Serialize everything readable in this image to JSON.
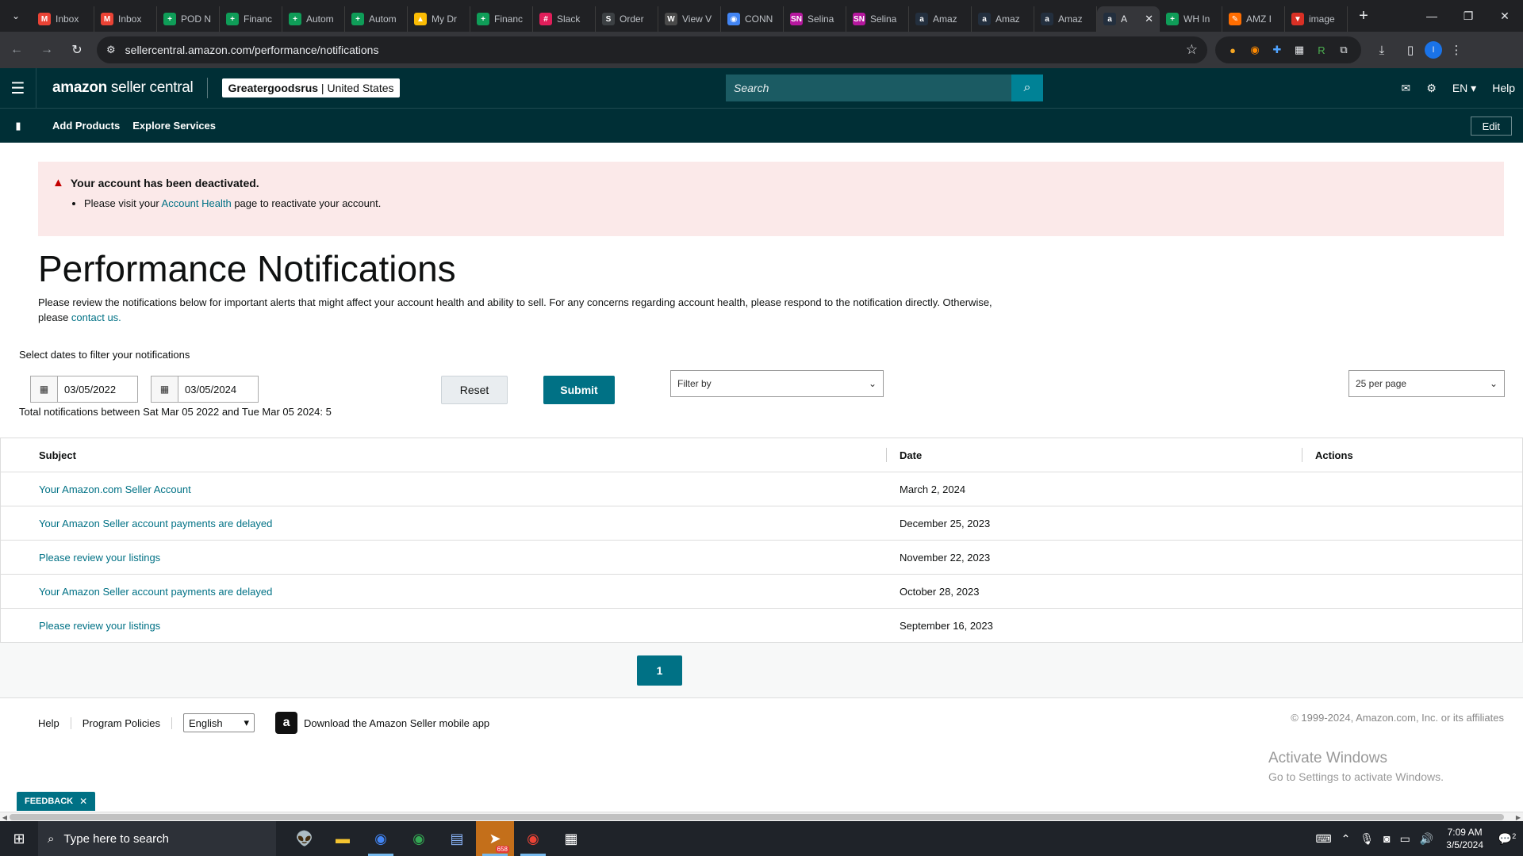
{
  "browser": {
    "tabs": [
      {
        "label": "Inbox",
        "icon": "gmail-icon",
        "color": "#ea4335",
        "glyph": "M"
      },
      {
        "label": "Inbox",
        "icon": "gmail-icon",
        "color": "#ea4335",
        "glyph": "M"
      },
      {
        "label": "POD N",
        "icon": "sheets-icon",
        "color": "#0f9d58",
        "glyph": "+"
      },
      {
        "label": "Financ",
        "icon": "sheets-icon",
        "color": "#0f9d58",
        "glyph": "+"
      },
      {
        "label": "Autom",
        "icon": "sheets-icon",
        "color": "#0f9d58",
        "glyph": "+"
      },
      {
        "label": "Autom",
        "icon": "sheets-icon",
        "color": "#0f9d58",
        "glyph": "+"
      },
      {
        "label": "My Dr",
        "icon": "drive-icon",
        "color": "#fbbc04",
        "glyph": "▲"
      },
      {
        "label": "Financ",
        "icon": "sheets-icon",
        "color": "#0f9d58",
        "glyph": "+"
      },
      {
        "label": "Slack",
        "icon": "slack-icon",
        "color": "#e01e5a",
        "glyph": "#"
      },
      {
        "label": "Order",
        "icon": "sw-icon",
        "color": "#3c4043",
        "glyph": "S"
      },
      {
        "label": "View V",
        "icon": "w-icon",
        "color": "#4a4a4a",
        "glyph": "W"
      },
      {
        "label": "CONN",
        "icon": "chrome-icon",
        "color": "#4285f4",
        "glyph": "◉"
      },
      {
        "label": "Selina",
        "icon": "sn-icon",
        "color": "#b5179e",
        "glyph": "SN"
      },
      {
        "label": "Selina",
        "icon": "sn-icon",
        "color": "#b5179e",
        "glyph": "SN"
      },
      {
        "label": "Amaz",
        "icon": "amazon-icon",
        "color": "#232f3e",
        "glyph": "a"
      },
      {
        "label": "Amaz",
        "icon": "amazon-icon",
        "color": "#232f3e",
        "glyph": "a"
      },
      {
        "label": "Amaz",
        "icon": "amazon-icon",
        "color": "#232f3e",
        "glyph": "a"
      },
      {
        "label": "A",
        "icon": "amazon-icon",
        "color": "#232f3e",
        "glyph": "a",
        "active": true
      },
      {
        "label": "WH In",
        "icon": "sheets-icon",
        "color": "#0f9d58",
        "glyph": "+"
      },
      {
        "label": "AMZ I",
        "icon": "pen-icon",
        "color": "#ff6d00",
        "glyph": "✎"
      },
      {
        "label": "image",
        "icon": "image-icon",
        "color": "#d93025",
        "glyph": "▼"
      }
    ],
    "url": "sellercentral.amazon.com/performance/notifications"
  },
  "header": {
    "logo_main": "amazon",
    "logo_sub": " seller central",
    "store_name": "Greatergoodsrus",
    "store_region": " | United States",
    "search_placeholder": "Search",
    "lang": "EN ▾",
    "help": "Help"
  },
  "nav": {
    "add_products": "Add Products",
    "explore_services": "Explore Services",
    "edit": "Edit"
  },
  "alert": {
    "title": "Your account has been deactivated.",
    "pre": "Please visit your ",
    "link": "Account Health",
    "post": " page to reactivate your account."
  },
  "page": {
    "title": "Performance Notifications",
    "desc_pre": "Please review the notifications below for important alerts that might affect your account health and ability to sell. For any concerns regarding account health, please respond to the notification directly. Otherwise, please ",
    "desc_link": "contact us.",
    "filter_label": "Select dates to filter your notifications",
    "date_from": "03/05/2022",
    "date_to": "03/05/2024",
    "reset": "Reset",
    "submit": "Submit",
    "filter_by": "Filter by",
    "per_page": "25 per page",
    "total": "Total notifications between Sat Mar 05 2022 and Tue Mar 05 2024: 5"
  },
  "table": {
    "headers": [
      "Subject",
      "Date",
      "Actions"
    ],
    "rows": [
      {
        "subject": "Your Amazon.com Seller Account",
        "date": "March 2, 2024"
      },
      {
        "subject": "Your Amazon Seller account payments are delayed",
        "date": "December 25, 2023"
      },
      {
        "subject": "Please review your listings",
        "date": "November 22, 2023"
      },
      {
        "subject": "Your Amazon Seller account payments are delayed",
        "date": "October 28, 2023"
      },
      {
        "subject": "Please review your listings",
        "date": "September 16, 2023"
      }
    ]
  },
  "pager": {
    "current": "1"
  },
  "footer": {
    "help": "Help",
    "policies": "Program Policies",
    "language": "English",
    "app_download": "Download the Amazon Seller mobile app",
    "copyright": "© 1999-2024, Amazon.com, Inc. or its affiliates"
  },
  "watermark": {
    "line1": "Activate Windows",
    "line2": "Go to Settings to activate Windows."
  },
  "feedback": "FEEDBACK",
  "taskbar": {
    "search_placeholder": "Type here to search",
    "time": "7:09 AM",
    "date": "3/5/2024",
    "notifications": "2",
    "telegram_badge": "658"
  }
}
